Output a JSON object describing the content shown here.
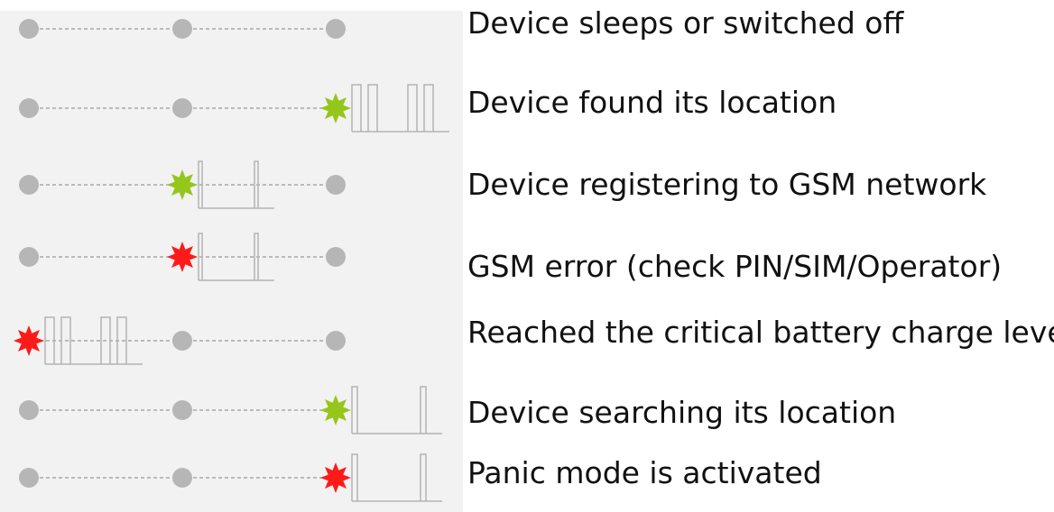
{
  "colors": {
    "led_off": "#b6b6b6",
    "led_green": "#94c61b",
    "led_red": "#ff1a1a",
    "wire": "#a8a8a8",
    "pulse": "#b3b3b3",
    "panel": "#f2f2f2"
  },
  "rows": [
    {
      "label": "Device sleeps or switched off",
      "leds": [
        "off",
        "off",
        "off"
      ],
      "active": -1,
      "pattern": "none"
    },
    {
      "label": "Device found its location",
      "leds": [
        "off",
        "off",
        "green"
      ],
      "active": 2,
      "pattern": "double"
    },
    {
      "label": "Device registering to GSM network",
      "leds": [
        "off",
        "green",
        "off"
      ],
      "active": 1,
      "pattern": "single"
    },
    {
      "label": "GSM error (check PIN/SIM/Operator)",
      "leds": [
        "off",
        "red",
        "off"
      ],
      "active": 1,
      "pattern": "single"
    },
    {
      "label": "Reached the critical battery charge level",
      "leds": [
        "red",
        "off",
        "off"
      ],
      "active": 0,
      "pattern": "double"
    },
    {
      "label": "Device searching its location",
      "leds": [
        "off",
        "off",
        "green"
      ],
      "active": 2,
      "pattern": "slow"
    },
    {
      "label": "Panic mode is activated",
      "leds": [
        "off",
        "off",
        "red"
      ],
      "active": 2,
      "pattern": "slow"
    }
  ]
}
